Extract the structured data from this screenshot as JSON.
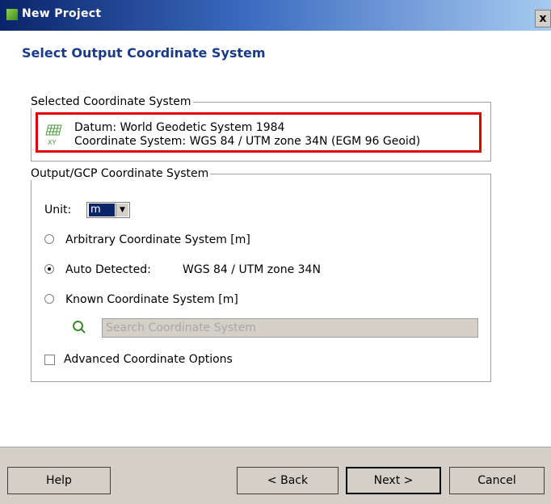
{
  "window": {
    "title": "New Project",
    "close_label": "x"
  },
  "page": {
    "heading": "Select Output Coordinate System"
  },
  "selected": {
    "legend": "Selected Coordinate System",
    "datum": "Datum: World Geodetic System 1984",
    "coordinate_system": "Coordinate System: WGS 84 / UTM zone 34N (EGM 96 Geoid)",
    "icon": "grid-xy-icon"
  },
  "output": {
    "legend": "Output/GCP Coordinate System",
    "unit_label": "Unit:",
    "unit_value": "m",
    "options": [
      {
        "label": "Arbitrary Coordinate System [m]",
        "checked": false
      },
      {
        "label": "Auto Detected:",
        "detail": "WGS 84 / UTM zone 34N",
        "checked": true
      },
      {
        "label": "Known Coordinate System [m]",
        "checked": false
      }
    ],
    "search_placeholder": "Search Coordinate System",
    "advanced_label": "Advanced Coordinate Options",
    "advanced_checked": false
  },
  "footer": {
    "help": "Help",
    "back": "< Back",
    "next": "Next >",
    "cancel": "Cancel"
  },
  "colors": {
    "heading": "#1a3a8a",
    "highlight": "#e00000",
    "titlebar": "#0a246a"
  }
}
